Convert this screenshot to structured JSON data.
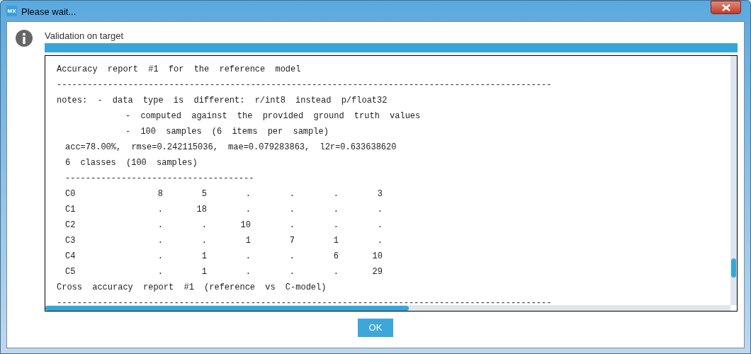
{
  "window": {
    "title": "Please wait...",
    "app_icon": "MX"
  },
  "message": "Validation on target",
  "progress": {
    "level": 1
  },
  "log_lines": [
    {
      "kind": "plain",
      "text": "Accuracy report #1 for the reference model"
    },
    {
      "kind": "plain",
      "text": "-------------------------------------------------------------------------------------------------"
    },
    {
      "kind": "plain",
      "text": "notes: - data type is different: r/int8 instead p/float32"
    },
    {
      "kind": "sub",
      "text": "- computed against the provided ground truth values"
    },
    {
      "kind": "sub",
      "text": "- 100 samples (6 items per sample)"
    },
    {
      "kind": "inset",
      "text": "acc=78.00%, rmse=0.242115036, mae=0.079283863, l2r=0.633638620"
    },
    {
      "kind": "inset",
      "text": "6 classes (100 samples)"
    },
    {
      "kind": "inset",
      "text": "-------------------------------------"
    },
    {
      "kind": "matrix",
      "label": "C0",
      "cells": [
        "8",
        "5",
        ".",
        ".",
        ".",
        "3"
      ]
    },
    {
      "kind": "matrix",
      "label": "C1",
      "cells": [
        ".",
        "18",
        ".",
        ".",
        ".",
        "."
      ]
    },
    {
      "kind": "matrix",
      "label": "C2",
      "cells": [
        ".",
        ".",
        "10",
        ".",
        ".",
        "."
      ]
    },
    {
      "kind": "matrix",
      "label": "C3",
      "cells": [
        ".",
        ".",
        "1",
        "7",
        "1",
        "."
      ]
    },
    {
      "kind": "matrix",
      "label": "C4",
      "cells": [
        ".",
        "1",
        ".",
        ".",
        "6",
        "10"
      ]
    },
    {
      "kind": "matrix",
      "label": "C5",
      "cells": [
        ".",
        "1",
        ".",
        ".",
        ".",
        "29"
      ]
    },
    {
      "kind": "plain",
      "text": "Cross accuracy report #1 (reference vs C-model)"
    },
    {
      "kind": "plain",
      "text": "-------------------------------------------------------------------------------------------------"
    }
  ],
  "buttons": [
    "OK"
  ]
}
